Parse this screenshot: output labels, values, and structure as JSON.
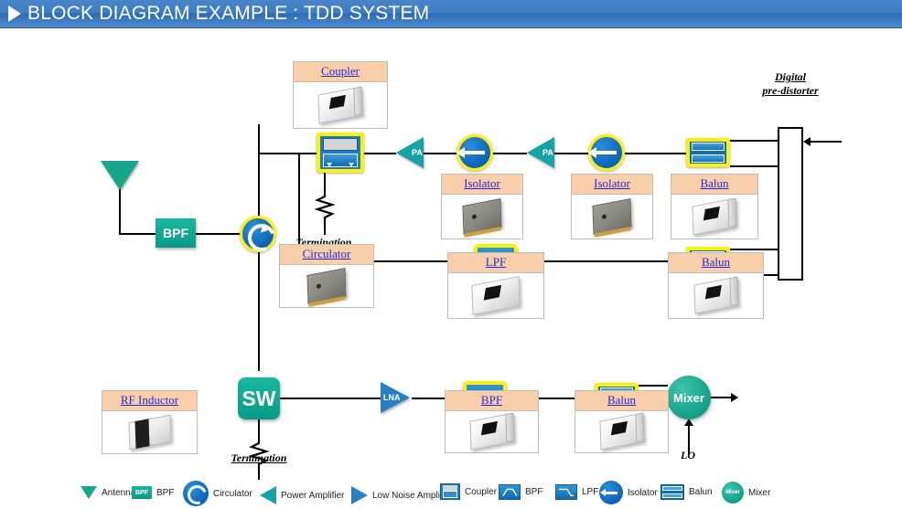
{
  "header": {
    "title": "BLOCK DIAGRAM EXAMPLE : TDD SYSTEM",
    "play_icon": "play-triangle-icon",
    "bg": "#3f7ec4"
  },
  "blocks": {
    "ant": "ANT",
    "bpf_block": "BPF",
    "sw": "SW",
    "mixer": "Mixer",
    "pa1": "PA",
    "pa2": "PA",
    "lna": "LNA"
  },
  "labels": {
    "digital_predistorter": "Digital\npre-distorter",
    "digital_predistorter_l1": "Digital",
    "digital_predistorter_l2": "pre-distorter",
    "termination_top": "Termination",
    "termination_bottom": "Termination",
    "lo": "LO"
  },
  "cards": [
    {
      "id": "coupler",
      "title": "Coupler",
      "photo": "white-chip-photo"
    },
    {
      "id": "isolator1",
      "title": "Isolator",
      "photo": "gray-chip-photo"
    },
    {
      "id": "isolator2",
      "title": "Isolator",
      "photo": "gray-chip-photo"
    },
    {
      "id": "balun1",
      "title": "Balun",
      "photo": "white-chip-photo"
    },
    {
      "id": "circulator",
      "title": "Circulator",
      "photo": "gray-chip-photo"
    },
    {
      "id": "lpf",
      "title": "LPF",
      "photo": "white-chip-photo"
    },
    {
      "id": "balun2",
      "title": "Balun",
      "photo": "white-chip-photo"
    },
    {
      "id": "rf_inductor",
      "title": "RF Inductor",
      "photo": "inductor-chip-photo"
    },
    {
      "id": "bpf_card",
      "title": "BPF",
      "photo": "white-chip-photo"
    },
    {
      "id": "balun3",
      "title": "Balun",
      "photo": "white-chip-photo"
    }
  ],
  "legend": [
    {
      "icon": "antenna-icon",
      "label": "Antenna"
    },
    {
      "icon": "bpf-block-icon",
      "label": "BPF",
      "chip_text": "BPF"
    },
    {
      "icon": "circulator-icon",
      "label": "Circulator"
    },
    {
      "icon": "power-amplifier-icon",
      "label": "Power Amplifier"
    },
    {
      "icon": "low-noise-amplifier-icon",
      "label": "Low Noise Amplifier"
    },
    {
      "icon": "coupler-icon",
      "label": "Coupler"
    },
    {
      "icon": "bpf-filter-icon",
      "label": "BPF"
    },
    {
      "icon": "lpf-filter-icon",
      "label": "LPF"
    },
    {
      "icon": "isolator-icon",
      "label": "Isolator"
    },
    {
      "icon": "balun-icon",
      "label": "Balun"
    },
    {
      "icon": "mixer-icon",
      "label": "Mixer",
      "chip_text": "Mixer"
    }
  ],
  "colors": {
    "header_blue": "#3f7ec4",
    "symbol_yellow": "#fff200",
    "symbol_blue": "#0b63b8",
    "teal": "#0a9a86",
    "pa_teal": "#17a3a3",
    "lna_blue": "#2a7fc4",
    "card_header_peach": "#f8cfa8",
    "link_blue": "#2727d8",
    "wire_black": "#000000"
  }
}
